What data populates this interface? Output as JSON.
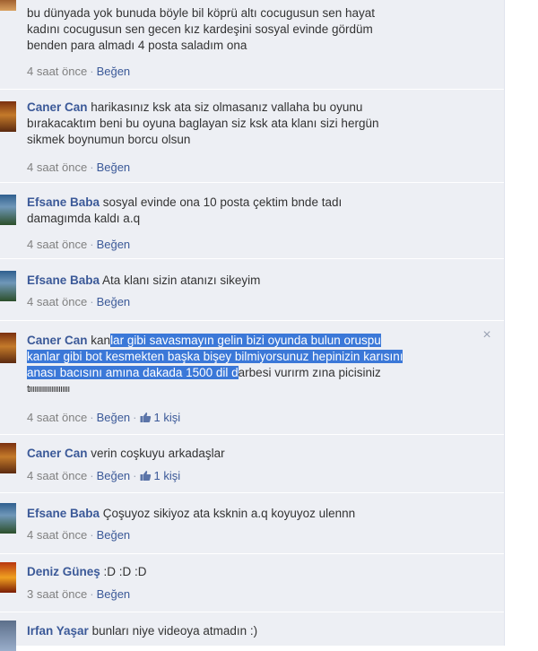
{
  "comments": [
    {
      "author": "",
      "lines": [
        "bu dünyada yok bunuda böyle bil köprü altı cocugusun sen hayat",
        "kadını cocugusun sen gecen kız kardeşini sosyal evinde gördüm",
        "benden para almadı 4 posta saladım ona"
      ],
      "time": "4 saat önce",
      "like": "Beğen"
    },
    {
      "author": "Caner Can",
      "lines": [
        " harikasınız ksk ata siz olmasanız vallaha bu oyunu",
        "bırakacaktım beni bu oyuna baglayan siz ksk ata klanı sizi hergün",
        "sikmek boynumun borcu olsun"
      ],
      "time": "4 saat önce",
      "like": "Beğen"
    },
    {
      "author": "Efsane Baba",
      "lines": [
        " sosyal evinde ona 10 posta çektim bnde tadı",
        "damagımda kaldı a.q"
      ],
      "time": "4 saat önce",
      "like": "Beğen"
    },
    {
      "author": "Efsane Baba",
      "lines": [
        " Ata klanı sizin atanızı sikeyim"
      ],
      "time": "4 saat önce",
      "like": "Beğen"
    },
    {
      "author": "Caner Can",
      "line1_plain": " kan",
      "line1_hl": "lar gibi savasmayın gelin bizi oyunda bulun oruspu",
      "line2_hl": "kanlar gibi bot kesmekten başka bişey bilmiyorsunuz hepinizin karısını",
      "line3_hl": "anası bacısını amına dakada 1500 dil d",
      "line3_plain": "arbesi vurırm zına picisiniz",
      "line4": "tıııııııııııııııııııııı",
      "time": "4 saat önce",
      "like": "Beğen",
      "likes_count": "1 kişi",
      "close": "×"
    },
    {
      "author": "Caner Can",
      "lines": [
        " verin coşkuyu arkadaşlar"
      ],
      "time": "4 saat önce",
      "like": "Beğen",
      "likes_count": "1 kişi"
    },
    {
      "author": "Efsane Baba",
      "lines": [
        " Çoşuyoz sikiyoz ata ksknin a.q koyuyoz ulennn"
      ],
      "time": "4 saat önce",
      "like": "Beğen"
    },
    {
      "author": "Deniz Güneş",
      "lines": [
        " :D :D :D"
      ],
      "time": "3 saat önce",
      "like": "Beğen"
    },
    {
      "author": "Irfan Yaşar",
      "lines": [
        " bunları niye videoya atmadın :)"
      ],
      "time": "",
      "like": ""
    }
  ],
  "separator": "·",
  "colors": {
    "link": "#3b5998",
    "background": "#edeff4",
    "highlight": "#3b78d8"
  }
}
